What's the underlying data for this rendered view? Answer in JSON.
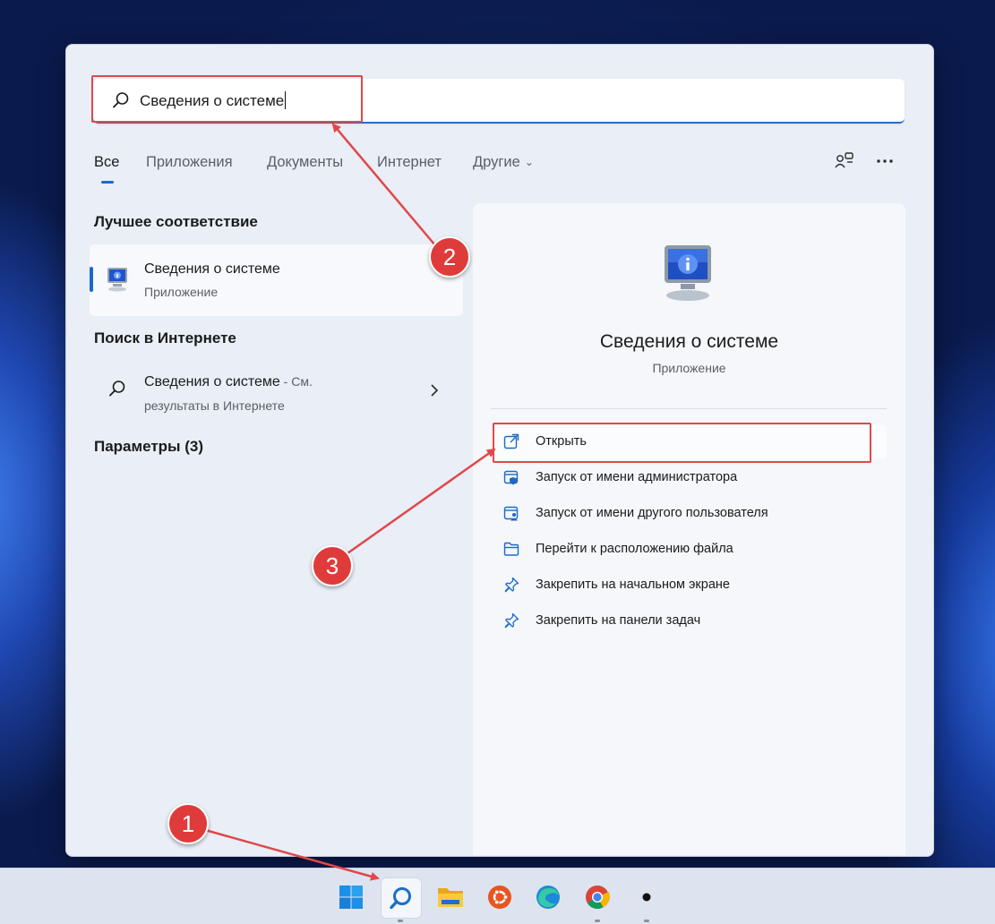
{
  "search": {
    "query": "Сведения о системе"
  },
  "tabs": [
    {
      "label": "Все",
      "active": true
    },
    {
      "label": "Приложения"
    },
    {
      "label": "Документы"
    },
    {
      "label": "Интернет"
    },
    {
      "label": "Другие"
    }
  ],
  "left": {
    "best_match_title": "Лучшее соответствие",
    "best_match": {
      "title": "Сведения о системе",
      "subtitle": "Приложение"
    },
    "web_search_title": "Поиск в Интернете",
    "web_result": {
      "title": "Сведения о системе",
      "suffix": " - См.",
      "subtitle": "результаты в Интернете"
    },
    "settings_title": "Параметры (3)"
  },
  "detail": {
    "title": "Сведения о системе",
    "subtitle": "Приложение",
    "actions": [
      {
        "label": "Открыть",
        "icon": "open-external-icon"
      },
      {
        "label": "Запуск от имени администратора",
        "icon": "run-as-admin-icon"
      },
      {
        "label": "Запуск от имени другого пользователя",
        "icon": "run-as-user-icon"
      },
      {
        "label": "Перейти к расположению файла",
        "icon": "folder-icon"
      },
      {
        "label": "Закрепить на начальном экране",
        "icon": "pin-icon"
      },
      {
        "label": "Закрепить на панели задач",
        "icon": "pin-icon"
      }
    ]
  },
  "taskbar": {
    "items": [
      "windows-start-icon",
      "search-icon",
      "file-explorer-icon",
      "ubuntu-icon",
      "edge-icon",
      "chrome-icon",
      "terminal-icon"
    ]
  },
  "annotations": {
    "badge1": "1",
    "badge2": "2",
    "badge3": "3"
  },
  "colors": {
    "accent": "#1b6ac9",
    "annotation": "#e0484a"
  }
}
